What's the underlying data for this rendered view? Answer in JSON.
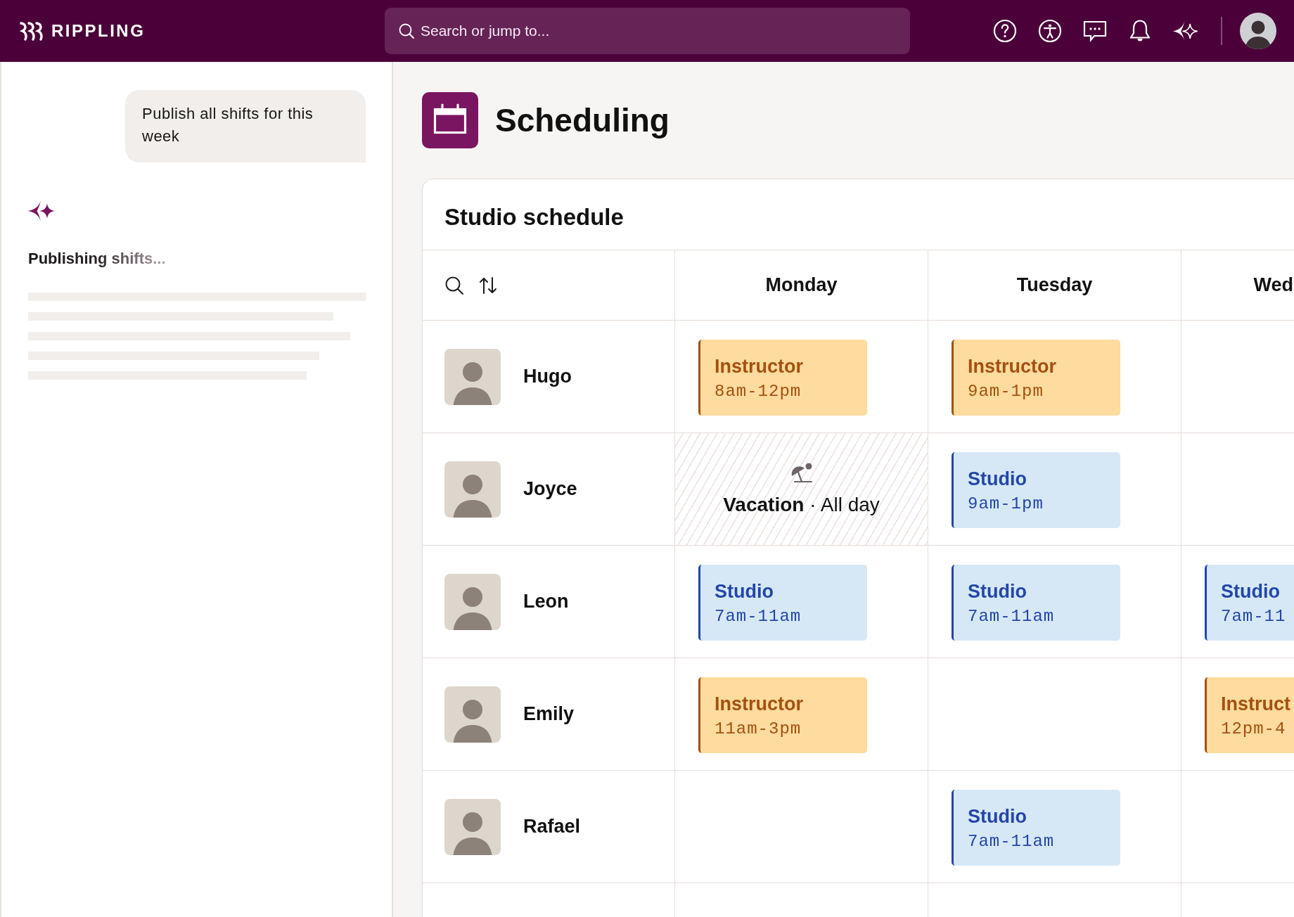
{
  "top_bar": {
    "logo": "RIPPLING",
    "search": {
      "placeholder": "Search or jump to..."
    }
  },
  "assistant": {
    "message": "Publish all shifts for this week",
    "status": {
      "text": "Publishing shifts...",
      "loading": true
    }
  },
  "page": {
    "title": "Scheduling"
  },
  "schedule": {
    "title": "Studio schedule",
    "columns": [
      "Monday",
      "Tuesday",
      "Wed"
    ],
    "rows": [
      {
        "name": "Hugo",
        "cells": [
          {
            "kind": "shift",
            "title": "Instructor",
            "time": "8am-12pm",
            "color": "#fedb9e"
          },
          {
            "kind": "shift",
            "title": "Instructor",
            "time": "9am-1pm",
            "color": "#fedb9e"
          },
          {
            "kind": "empty"
          }
        ]
      },
      {
        "name": "Joyce",
        "cells": [
          {
            "kind": "time_off",
            "text": "**Vacation** · All day"
          },
          {
            "kind": "shift",
            "title": "Studio",
            "time": "9am-1pm",
            "color": "#d6e8f6"
          },
          {
            "kind": "empty"
          }
        ]
      },
      {
        "name": "Leon",
        "cells": [
          {
            "kind": "shift",
            "title": "Studio",
            "time": "7am-11am",
            "color": "#d6e8f6"
          },
          {
            "kind": "shift",
            "title": "Studio",
            "time": "7am-11am",
            "color": "#d6e8f6"
          },
          {
            "kind": "shift",
            "title": "Studio",
            "time": "7am-11",
            "color": "#d6e8f6"
          }
        ]
      },
      {
        "name": "Emily",
        "cells": [
          {
            "kind": "shift",
            "title": "Instructor",
            "time": "11am-3pm",
            "color": "#fedb9e"
          },
          {
            "kind": "empty"
          },
          {
            "kind": "shift",
            "title": "Instruct",
            "time": "12pm-4",
            "color": "#fedb9e"
          }
        ]
      },
      {
        "name": "Rafael",
        "cells": [
          {
            "kind": "empty"
          },
          {
            "kind": "shift",
            "title": "Studio",
            "time": "7am-11am",
            "color": "#d6e8f6"
          },
          {
            "kind": "empty"
          }
        ]
      }
    ]
  }
}
